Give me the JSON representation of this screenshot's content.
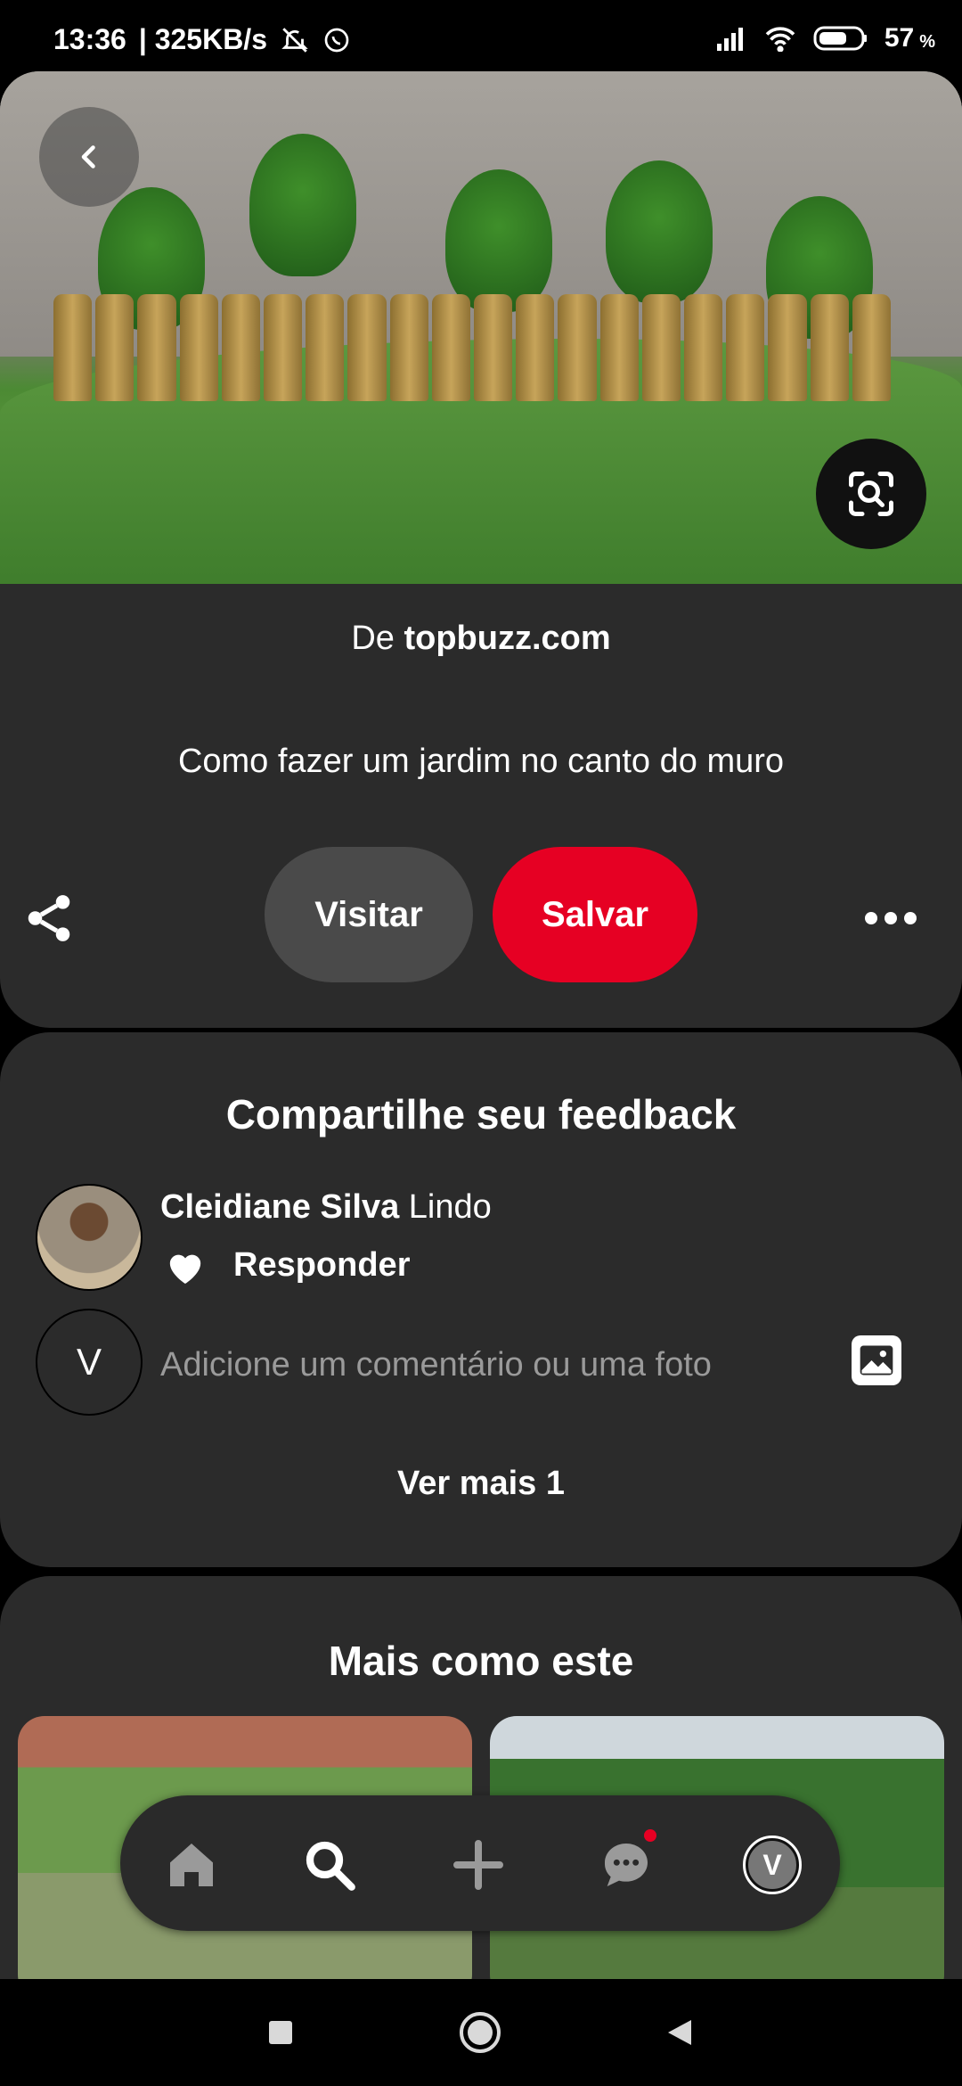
{
  "status_bar": {
    "time": "13:36",
    "speed": "| 325KB/s",
    "battery": "57",
    "battery_unit": "%"
  },
  "pin": {
    "source_prefix": "De",
    "source_domain": "topbuzz.com",
    "title": "Como fazer um jardim no canto do muro",
    "visit_label": "Visitar",
    "save_label": "Salvar",
    "save_color": "#e60023"
  },
  "feedback": {
    "title": "Compartilhe seu feedback",
    "comment": {
      "author": "Cleidiane Silva",
      "text": "Lindo",
      "reply_label": "Responder"
    },
    "input_avatar_letter": "V",
    "input_placeholder": "Adicione um comentário ou uma foto",
    "see_more_label": "Ver mais 1"
  },
  "more_like_this": {
    "title": "Mais como este"
  },
  "bottom_nav": {
    "items": [
      "home-icon",
      "search-icon",
      "plus-icon",
      "messages-icon",
      "profile-avatar"
    ],
    "profile_letter": "V"
  },
  "system_nav": [
    "recents-icon",
    "home-circle-icon",
    "back-triangle-icon"
  ]
}
